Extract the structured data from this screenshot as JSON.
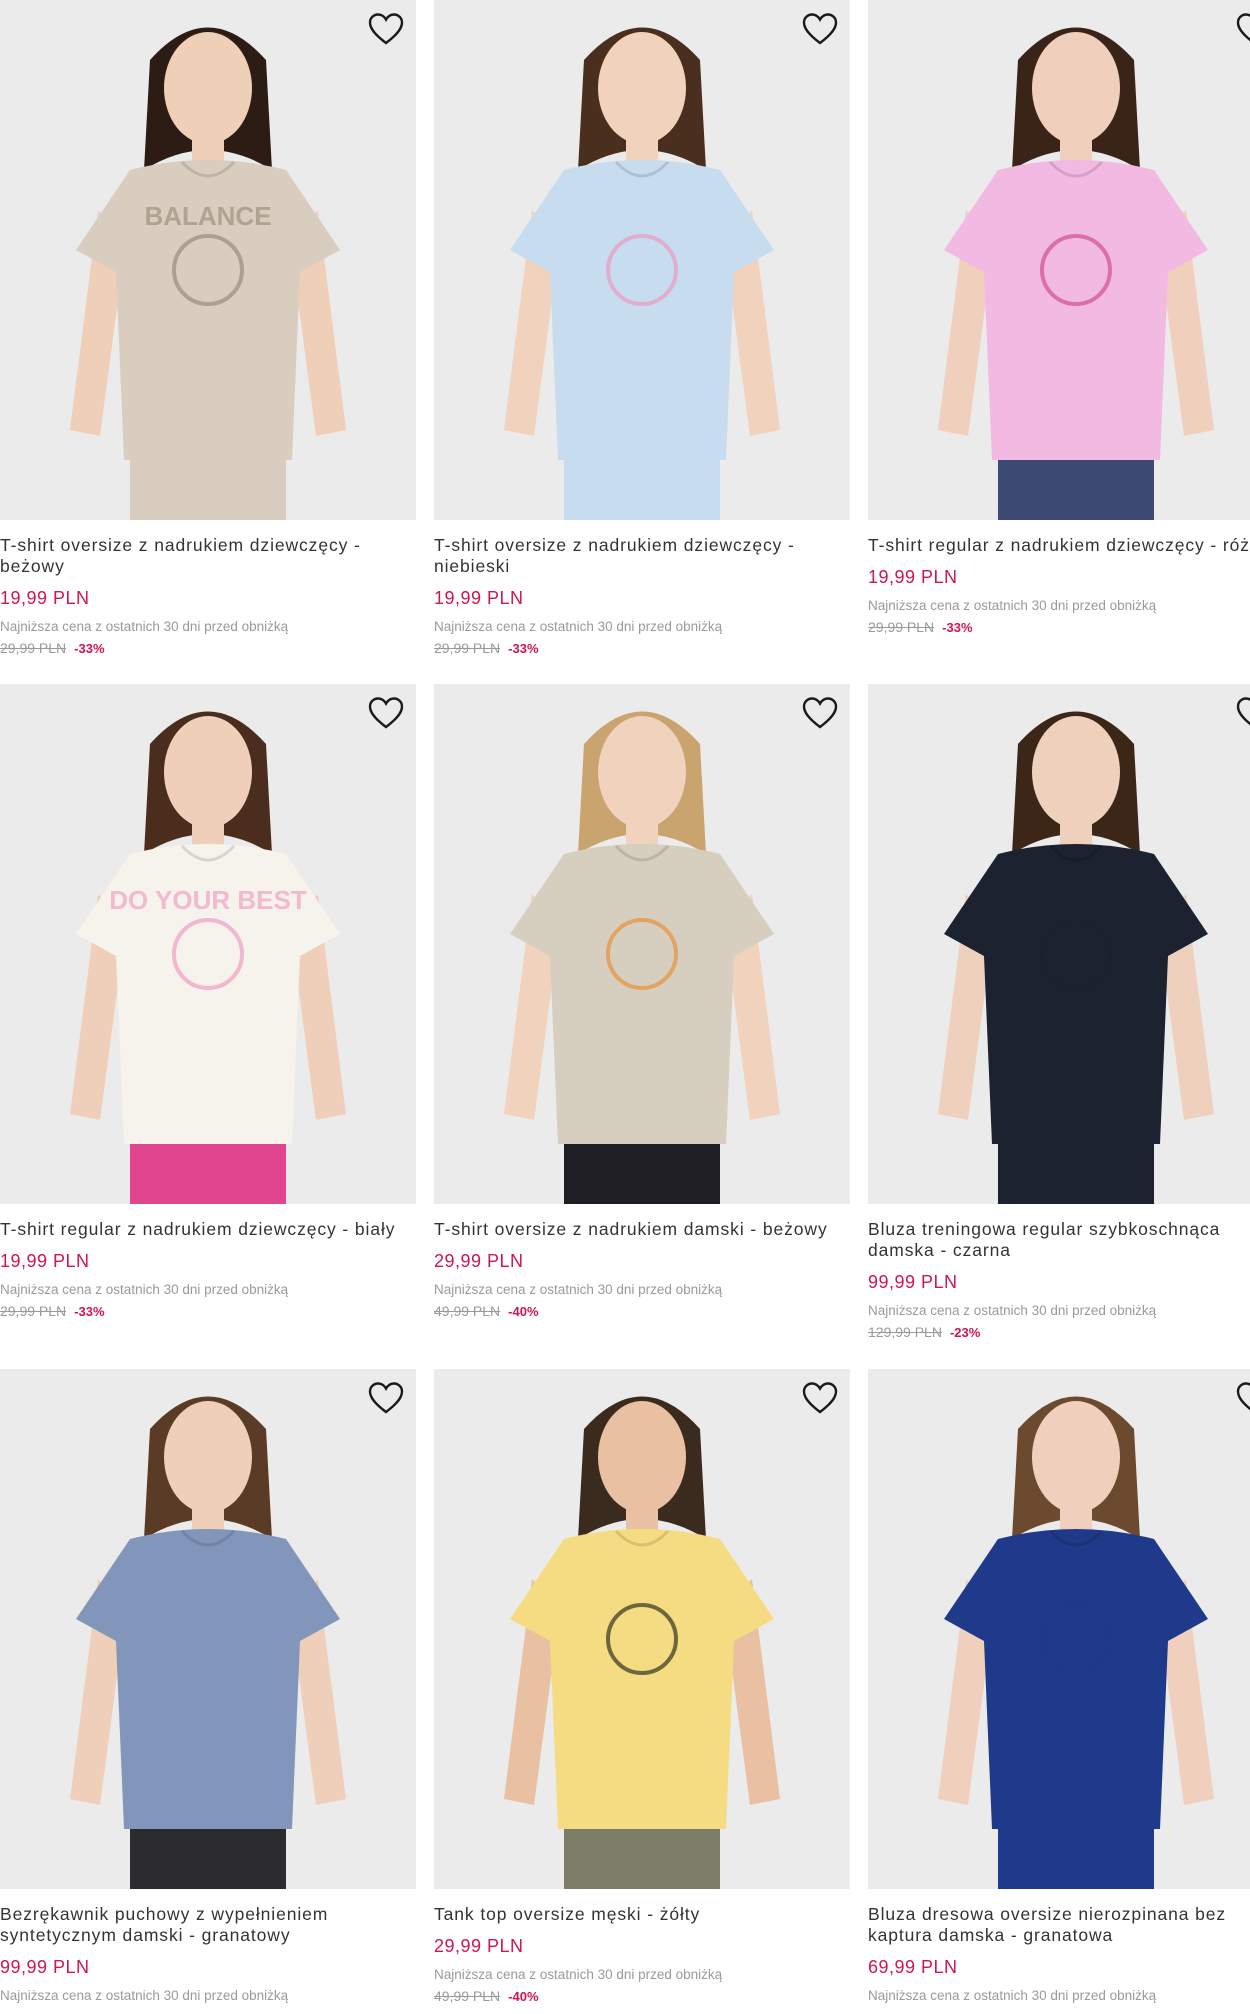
{
  "accent_color": "#d0154f",
  "products": [
    {
      "name": "T-shirt oversize z nadrukiem dziewczęcy - beżowy",
      "price": "19,99 PLN",
      "lowest_label": "Najniższa cena z ostatnich 30 dni przed obniżką",
      "old_price": "29,99 PLN",
      "discount": "-33%",
      "shirt_color": "#d8cdbf",
      "skin": "#efcfb8",
      "hair": "#2c1c14",
      "bottom": "#d8cdbf",
      "print_text": "BALANCE",
      "print_color": "#a39584"
    },
    {
      "name": "T-shirt oversize z nadrukiem dziewczęcy - niebieski",
      "price": "19,99 PLN",
      "lowest_label": "Najniższa cena z ostatnich 30 dni przed obniżką",
      "old_price": "29,99 PLN",
      "discount": "-33%",
      "shirt_color": "#c7dcef",
      "skin": "#f1d2bd",
      "hair": "#4a2e1e",
      "bottom": "#c7dcef",
      "print_text": "",
      "print_color": "#e7a2c6"
    },
    {
      "name": "T-shirt regular z nadrukiem dziewczęcy - różowy",
      "price": "19,99 PLN",
      "lowest_label": "Najniższa cena z ostatnich 30 dni przed obniżką",
      "old_price": "29,99 PLN",
      "discount": "-33%",
      "shirt_color": "#f2b9e3",
      "skin": "#f0d0bc",
      "hair": "#3a2418",
      "bottom": "#3d4a73",
      "print_text": "",
      "print_color": "#d35c9b"
    },
    {
      "name": "T-shirt regular z nadrukiem dziewczęcy - biały",
      "price": "19,99 PLN",
      "lowest_label": "Najniższa cena z ostatnich 30 dni przed obniżką",
      "old_price": "29,99 PLN",
      "discount": "-33%",
      "shirt_color": "#f6f2ec",
      "skin": "#efcfb9",
      "hair": "#4a2d1c",
      "bottom": "#e0458d",
      "print_text": "DO YOUR BEST",
      "print_color": "#f2a6c9"
    },
    {
      "name": "T-shirt oversize z nadrukiem damski - beżowy",
      "price": "29,99 PLN",
      "lowest_label": "Najniższa cena z ostatnich 30 dni przed obniżką",
      "old_price": "49,99 PLN",
      "discount": "-40%",
      "shirt_color": "#d6cebf",
      "skin": "#f0d2bd",
      "hair": "#c9a46e",
      "bottom": "#1e1e24",
      "print_text": "",
      "print_color": "#e59a4b"
    },
    {
      "name": "Bluza treningowa regular szybkoschnąca damska - czarna",
      "price": "99,99 PLN",
      "lowest_label": "Najniższa cena z ostatnich 30 dni przed obniżką",
      "old_price": "129,99 PLN",
      "discount": "-23%",
      "shirt_color": "#1c2230",
      "skin": "#efd0bd",
      "hair": "#3b2618",
      "bottom": "#1c2230",
      "print_text": "",
      "print_color": "#1c2230"
    },
    {
      "name": "Bezrękawnik puchowy z wypełnieniem syntetycznym damski - granatowy",
      "price": "99,99 PLN",
      "lowest_label": "Najniższa cena z ostatnich 30 dni przed obniżką",
      "old_price": "",
      "discount": "",
      "shirt_color": "#8296bb",
      "skin": "#efcfba",
      "hair": "#5a3b26",
      "bottom": "#2c2c30",
      "print_text": "",
      "print_color": "#8296bb"
    },
    {
      "name": "Tank top oversize męski - żółty",
      "price": "29,99 PLN",
      "lowest_label": "Najniższa cena z ostatnich 30 dni przed obniżką",
      "old_price": "49,99 PLN",
      "discount": "-40%",
      "shirt_color": "#f5dc82",
      "skin": "#e9c0a1",
      "hair": "#3b2a1e",
      "bottom": "#7c7d66",
      "print_text": "",
      "print_color": "#4a4a2a"
    },
    {
      "name": "Bluza dresowa oversize nierozpinana bez kaptura damska - granatowa",
      "price": "69,99 PLN",
      "lowest_label": "Najniższa cena z ostatnich 30 dni przed obniżką",
      "old_price": "",
      "discount": "",
      "shirt_color": "#1f3a8a",
      "skin": "#f0d0bd",
      "hair": "#6b4a30",
      "bottom": "#1f3a8a",
      "print_text": "",
      "print_color": "#1f3a8a"
    }
  ],
  "icons": {
    "favorite": "heart-outline-icon"
  }
}
